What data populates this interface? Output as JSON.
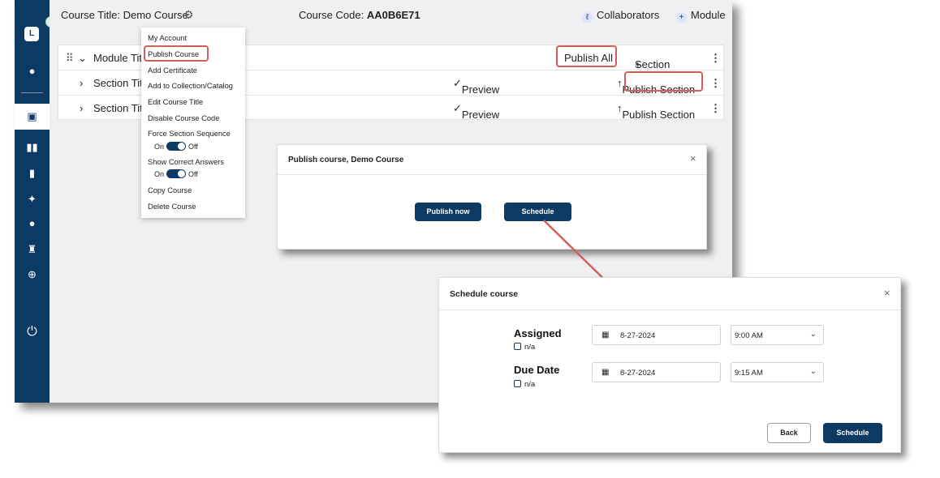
{
  "sidebar": {
    "avatar_letter": "L",
    "icons": [
      "user-icon",
      "book-icon",
      "library-icon",
      "notebook-icon",
      "sparkle-icon",
      "chat-icon",
      "cake-icon",
      "plus-circle-icon",
      "power-icon"
    ]
  },
  "topbar": {
    "course_title": "Course Title: Demo Course",
    "course_code_label": "Course Code:",
    "course_code_value": "AA0B6E71",
    "collaborators": "Collaborators",
    "module": "Module"
  },
  "table": {
    "module_row": {
      "label": "Module Titl",
      "publish_all": "Publish All",
      "section": "Section"
    },
    "section_rows": [
      {
        "label": "Section Titl",
        "preview": "Preview",
        "publish": "Publish Section"
      },
      {
        "label": "Section Titl",
        "preview": "Preview",
        "publish": "Publish Section"
      }
    ]
  },
  "menu": {
    "items": [
      "My Account",
      "Publish Course",
      "Add Certificate",
      "Add to Collection/Catalog",
      "Edit Course Title",
      "Disable Course Code",
      "Force Section Sequence",
      "Show Correct Answers",
      "Copy Course",
      "Delete Course"
    ],
    "toggle_on": "On",
    "toggle_off": "Off"
  },
  "publish_modal": {
    "title": "Publish course, Demo Course",
    "publish_now": "Publish now",
    "schedule": "Schedule"
  },
  "schedule_modal": {
    "title": "Schedule course",
    "assigned_label": "Assigned",
    "due_label": "Due Date",
    "na": "n/a",
    "assigned_date": "8-27-2024",
    "assigned_time": "9:00 AM",
    "due_date": "8-27-2024",
    "due_time": "9:15 AM",
    "back": "Back",
    "schedule": "Schedule"
  },
  "colors": {
    "brand": "#0d3a63",
    "highlight": "#d0605a",
    "arrow": "#d0605a"
  }
}
